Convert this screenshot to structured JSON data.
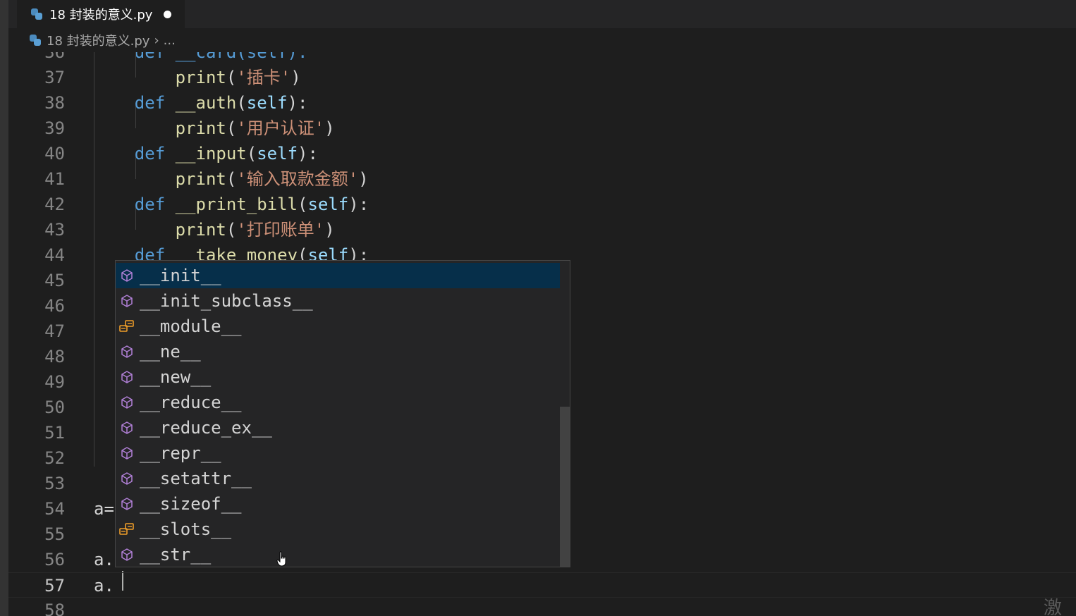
{
  "tab": {
    "title": "18 封装的意义.py"
  },
  "breadcrumb": {
    "file": "18 封装的意义.py",
    "separator": "›",
    "more": "..."
  },
  "editor": {
    "partial_line": {
      "number": "36",
      "code": "    def __card(self):"
    },
    "lines": [
      {
        "number": "37",
        "tokens": [
          [
            "        ",
            "pun"
          ],
          [
            "print",
            "fn"
          ],
          [
            "(",
            "pun"
          ],
          [
            "'插卡'",
            "str"
          ],
          [
            ")",
            "pun"
          ]
        ]
      },
      {
        "number": "38",
        "tokens": [
          [
            "    ",
            "pun"
          ],
          [
            "def",
            "kw"
          ],
          [
            " ",
            "pun"
          ],
          [
            "__auth",
            "fn"
          ],
          [
            "(",
            "pun"
          ],
          [
            "self",
            "slf"
          ],
          [
            "):",
            "pun"
          ]
        ]
      },
      {
        "number": "39",
        "tokens": [
          [
            "        ",
            "pun"
          ],
          [
            "print",
            "fn"
          ],
          [
            "(",
            "pun"
          ],
          [
            "'用户认证'",
            "str"
          ],
          [
            ")",
            "pun"
          ]
        ]
      },
      {
        "number": "40",
        "tokens": [
          [
            "    ",
            "pun"
          ],
          [
            "def",
            "kw"
          ],
          [
            " ",
            "pun"
          ],
          [
            "__input",
            "fn"
          ],
          [
            "(",
            "pun"
          ],
          [
            "self",
            "slf"
          ],
          [
            "):",
            "pun"
          ]
        ]
      },
      {
        "number": "41",
        "tokens": [
          [
            "        ",
            "pun"
          ],
          [
            "print",
            "fn"
          ],
          [
            "(",
            "pun"
          ],
          [
            "'输入取款金额'",
            "str"
          ],
          [
            ")",
            "pun"
          ]
        ]
      },
      {
        "number": "42",
        "tokens": [
          [
            "    ",
            "pun"
          ],
          [
            "def",
            "kw"
          ],
          [
            " ",
            "pun"
          ],
          [
            "__print_bill",
            "fn"
          ],
          [
            "(",
            "pun"
          ],
          [
            "self",
            "slf"
          ],
          [
            "):",
            "pun"
          ]
        ]
      },
      {
        "number": "43",
        "tokens": [
          [
            "        ",
            "pun"
          ],
          [
            "print",
            "fn"
          ],
          [
            "(",
            "pun"
          ],
          [
            "'打印账单'",
            "str"
          ],
          [
            ")",
            "pun"
          ]
        ]
      },
      {
        "number": "44",
        "tokens": [
          [
            "    ",
            "pun"
          ],
          [
            "def",
            "kw"
          ],
          [
            " ",
            "pun"
          ],
          [
            "__take_money",
            "fn"
          ],
          [
            "(",
            "pun"
          ],
          [
            "self",
            "slf"
          ],
          [
            "):",
            "pun"
          ]
        ]
      },
      {
        "number": "45",
        "tokens": []
      },
      {
        "number": "46",
        "tokens": []
      },
      {
        "number": "47",
        "tokens": []
      },
      {
        "number": "48",
        "tokens": []
      },
      {
        "number": "49",
        "tokens": []
      },
      {
        "number": "50",
        "tokens": []
      },
      {
        "number": "51",
        "tokens": []
      },
      {
        "number": "52",
        "tokens": []
      },
      {
        "number": "53",
        "tokens": []
      },
      {
        "number": "54",
        "tokens": [
          [
            "a=",
            "pun"
          ]
        ]
      },
      {
        "number": "55",
        "tokens": []
      },
      {
        "number": "56",
        "tokens": [
          [
            "a.",
            "pun"
          ]
        ]
      },
      {
        "number": "57",
        "tokens": [
          [
            "a.",
            "pun"
          ]
        ],
        "current": true
      },
      {
        "number": "58",
        "tokens": []
      }
    ]
  },
  "suggest": {
    "items": [
      {
        "label": "__init__",
        "kind": "method-cube-icon",
        "selected": true
      },
      {
        "label": "__init_subclass__",
        "kind": "method-cube-icon"
      },
      {
        "label": "__module__",
        "kind": "variable-icon"
      },
      {
        "label": "__ne__",
        "kind": "method-cube-icon"
      },
      {
        "label": "__new__",
        "kind": "method-cube-icon"
      },
      {
        "label": "__reduce__",
        "kind": "method-cube-icon"
      },
      {
        "label": "__reduce_ex__",
        "kind": "method-cube-icon"
      },
      {
        "label": "__repr__",
        "kind": "method-cube-icon"
      },
      {
        "label": "__setattr__",
        "kind": "method-cube-icon"
      },
      {
        "label": "__sizeof__",
        "kind": "method-cube-icon"
      },
      {
        "label": "__slots__",
        "kind": "variable-icon"
      },
      {
        "label": "__str__",
        "kind": "method-cube-icon"
      }
    ]
  },
  "watermark": {
    "text": "激活"
  },
  "colors": {
    "selected": "#062f4a",
    "method": "#b180d7",
    "variable": "#ee9d28"
  }
}
